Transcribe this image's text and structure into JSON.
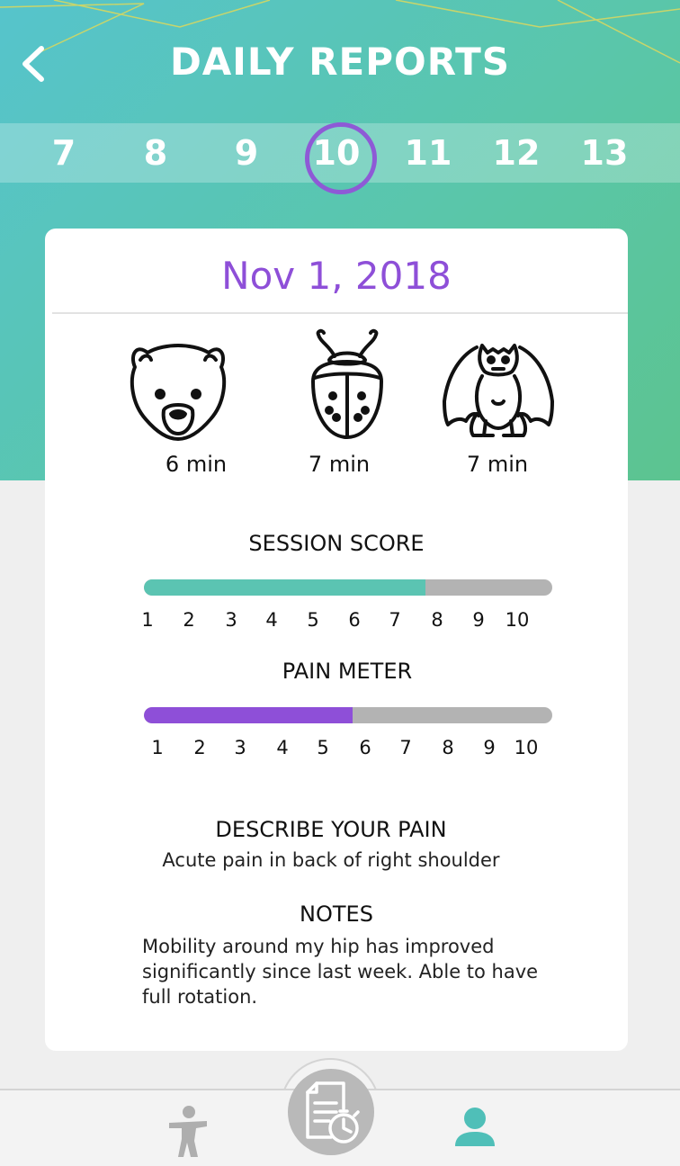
{
  "header": {
    "title": "DAILY REPORTS"
  },
  "date_strip": {
    "days": [
      "7",
      "8",
      "9",
      "10",
      "11",
      "12",
      "13"
    ],
    "selected": "10"
  },
  "report": {
    "date": "Nov 1, 2018",
    "creatures": [
      {
        "icon": "bear-icon",
        "duration": "6 min"
      },
      {
        "icon": "beetle-icon",
        "duration": "7 min"
      },
      {
        "icon": "gargoyle-icon",
        "duration": "7 min"
      }
    ],
    "session_score": {
      "title": "SESSION SCORE",
      "value": 0.69,
      "color": "#5bc4b2",
      "scale": [
        "1",
        "2",
        "3",
        "4",
        "5",
        "6",
        "7",
        "8",
        "9",
        "10"
      ]
    },
    "pain_meter": {
      "title": "PAIN METER",
      "value": 0.51,
      "color": "#8e4fd8",
      "scale": [
        "1",
        "2",
        "3",
        "4",
        "5",
        "6",
        "7",
        "8",
        "9",
        "10"
      ]
    },
    "describe_pain": {
      "title": "DESCRIBE YOUR PAIN",
      "text": "Acute pain in back of right shoulder"
    },
    "notes": {
      "title": "NOTES",
      "lines": [
        "Mobility around my hip has improved",
        "significantly since last week. Able to have",
        "full rotation."
      ]
    }
  },
  "bottom_nav": {
    "items": [
      {
        "icon": "exercise-figure-icon"
      },
      {
        "icon": "report-timer-icon"
      },
      {
        "icon": "profile-icon"
      }
    ],
    "active_color": "#4fbfb8"
  }
}
